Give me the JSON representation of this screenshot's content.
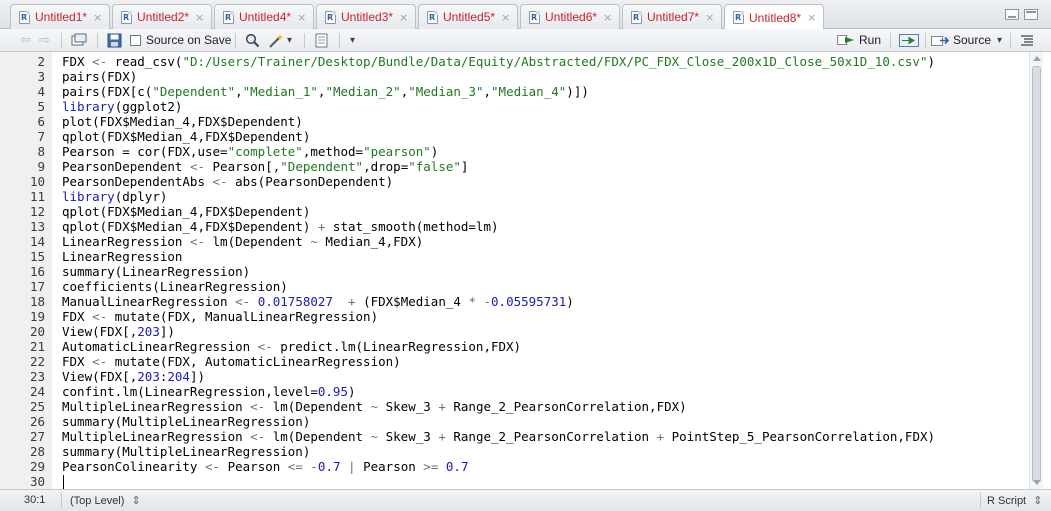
{
  "tabs": [
    {
      "label": "Untitled1*",
      "active": false
    },
    {
      "label": "Untitled2*",
      "active": false
    },
    {
      "label": "Untitled4*",
      "active": false
    },
    {
      "label": "Untitled3*",
      "active": false
    },
    {
      "label": "Untitled5*",
      "active": false
    },
    {
      "label": "Untitled6*",
      "active": false
    },
    {
      "label": "Untitled7*",
      "active": false
    },
    {
      "label": "Untitled8*",
      "active": true
    }
  ],
  "tab_close_glyph": "×",
  "toolbar": {
    "source_on_save_label": "Source on Save",
    "source_on_save_checked": false,
    "run_label": "Run",
    "source_label": "Source",
    "dropdown_glyph": "▾"
  },
  "lines": [
    {
      "n": "2",
      "tokens": [
        [
          "t",
          "FDX "
        ],
        [
          "op",
          "<-"
        ],
        [
          "t",
          " read_csv("
        ],
        [
          "str",
          "\"D:/Users/Trainer/Desktop/Bundle/Data/Equity/Abstracted/FDX/PC_FDX_Close_200x1D_Close_50x1D_10.csv\""
        ],
        [
          "t",
          ")"
        ]
      ]
    },
    {
      "n": "3",
      "tokens": [
        [
          "t",
          "pairs(FDX)"
        ]
      ]
    },
    {
      "n": "4",
      "tokens": [
        [
          "t",
          "pairs(FDX[c("
        ],
        [
          "str",
          "\"Dependent\""
        ],
        [
          "t",
          ","
        ],
        [
          "str",
          "\"Median_1\""
        ],
        [
          "t",
          ","
        ],
        [
          "str",
          "\"Median_2\""
        ],
        [
          "t",
          ","
        ],
        [
          "str",
          "\"Median_3\""
        ],
        [
          "t",
          ","
        ],
        [
          "str",
          "\"Median_4\""
        ],
        [
          "t",
          ")])"
        ]
      ]
    },
    {
      "n": "5",
      "tokens": [
        [
          "kw",
          "library"
        ],
        [
          "t",
          "(ggplot2)"
        ]
      ]
    },
    {
      "n": "6",
      "tokens": [
        [
          "t",
          "plot(FDX$Median_4,FDX$Dependent)"
        ]
      ]
    },
    {
      "n": "7",
      "tokens": [
        [
          "t",
          "qplot(FDX$Median_4,FDX$Dependent)"
        ]
      ]
    },
    {
      "n": "8",
      "tokens": [
        [
          "t",
          "Pearson = cor(FDX,use="
        ],
        [
          "str",
          "\"complete\""
        ],
        [
          "t",
          ",method="
        ],
        [
          "str",
          "\"pearson\""
        ],
        [
          "t",
          ")"
        ]
      ]
    },
    {
      "n": "9",
      "tokens": [
        [
          "t",
          "PearsonDependent "
        ],
        [
          "op",
          "<-"
        ],
        [
          "t",
          " Pearson[,"
        ],
        [
          "str",
          "\"Dependent\""
        ],
        [
          "t",
          ",drop="
        ],
        [
          "str",
          "\"false\""
        ],
        [
          "t",
          "]"
        ]
      ]
    },
    {
      "n": "10",
      "tokens": [
        [
          "t",
          "PearsonDependentAbs "
        ],
        [
          "op",
          "<-"
        ],
        [
          "t",
          " abs(PearsonDependent)"
        ]
      ]
    },
    {
      "n": "11",
      "tokens": [
        [
          "kw",
          "library"
        ],
        [
          "t",
          "(dplyr)"
        ]
      ]
    },
    {
      "n": "12",
      "tokens": [
        [
          "t",
          "qplot(FDX$Median_4,FDX$Dependent)"
        ]
      ]
    },
    {
      "n": "13",
      "tokens": [
        [
          "t",
          "qplot(FDX$Median_4,FDX$Dependent) "
        ],
        [
          "op",
          "+"
        ],
        [
          "t",
          " stat_smooth(method=lm)"
        ]
      ]
    },
    {
      "n": "14",
      "tokens": [
        [
          "t",
          "LinearRegression "
        ],
        [
          "op",
          "<-"
        ],
        [
          "t",
          " lm(Dependent "
        ],
        [
          "op",
          "~"
        ],
        [
          "t",
          " Median_4,FDX)"
        ]
      ]
    },
    {
      "n": "15",
      "tokens": [
        [
          "t",
          "LinearRegression"
        ]
      ]
    },
    {
      "n": "16",
      "tokens": [
        [
          "t",
          "summary(LinearRegression)"
        ]
      ]
    },
    {
      "n": "17",
      "tokens": [
        [
          "t",
          "coefficients(LinearRegression)"
        ]
      ]
    },
    {
      "n": "18",
      "tokens": [
        [
          "t",
          "ManualLinearRegression "
        ],
        [
          "op",
          "<-"
        ],
        [
          "t",
          " "
        ],
        [
          "num",
          "0.01758027"
        ],
        [
          "t",
          "  "
        ],
        [
          "op",
          "+"
        ],
        [
          "t",
          " (FDX$Median_4 "
        ],
        [
          "op",
          "*"
        ],
        [
          "t",
          " "
        ],
        [
          "op",
          "-"
        ],
        [
          "num",
          "0.05595731"
        ],
        [
          "t",
          ")"
        ]
      ]
    },
    {
      "n": "19",
      "tokens": [
        [
          "t",
          "FDX "
        ],
        [
          "op",
          "<-"
        ],
        [
          "t",
          " mutate(FDX, ManualLinearRegression)"
        ]
      ]
    },
    {
      "n": "20",
      "tokens": [
        [
          "t",
          "View(FDX[,"
        ],
        [
          "num",
          "203"
        ],
        [
          "t",
          "])"
        ]
      ]
    },
    {
      "n": "21",
      "tokens": [
        [
          "t",
          "AutomaticLinearRegression "
        ],
        [
          "op",
          "<-"
        ],
        [
          "t",
          " predict.lm(LinearRegression,FDX)"
        ]
      ]
    },
    {
      "n": "22",
      "tokens": [
        [
          "t",
          "FDX "
        ],
        [
          "op",
          "<-"
        ],
        [
          "t",
          " mutate(FDX, AutomaticLinearRegression)"
        ]
      ]
    },
    {
      "n": "23",
      "tokens": [
        [
          "t",
          "View(FDX[,"
        ],
        [
          "num",
          "203"
        ],
        [
          "t",
          ":"
        ],
        [
          "num",
          "204"
        ],
        [
          "t",
          "])"
        ]
      ]
    },
    {
      "n": "24",
      "tokens": [
        [
          "t",
          "confint.lm(LinearRegression,level="
        ],
        [
          "num",
          "0.95"
        ],
        [
          "t",
          ")"
        ]
      ]
    },
    {
      "n": "25",
      "tokens": [
        [
          "t",
          "MultipleLinearRegression "
        ],
        [
          "op",
          "<-"
        ],
        [
          "t",
          " lm(Dependent "
        ],
        [
          "op",
          "~"
        ],
        [
          "t",
          " Skew_3 "
        ],
        [
          "op",
          "+"
        ],
        [
          "t",
          " Range_2_PearsonCorrelation,FDX)"
        ]
      ]
    },
    {
      "n": "26",
      "tokens": [
        [
          "t",
          "summary(MultipleLinearRegression)"
        ]
      ]
    },
    {
      "n": "27",
      "tokens": [
        [
          "t",
          "MultipleLinearRegression "
        ],
        [
          "op",
          "<-"
        ],
        [
          "t",
          " lm(Dependent "
        ],
        [
          "op",
          "~"
        ],
        [
          "t",
          " Skew_3 "
        ],
        [
          "op",
          "+"
        ],
        [
          "t",
          " Range_2_PearsonCorrelation "
        ],
        [
          "op",
          "+"
        ],
        [
          "t",
          " PointStep_5_PearsonCorrelation,FDX)"
        ]
      ]
    },
    {
      "n": "28",
      "tokens": [
        [
          "t",
          "summary(MultipleLinearRegression)"
        ]
      ]
    },
    {
      "n": "29",
      "tokens": [
        [
          "t",
          "PearsonColinearity "
        ],
        [
          "op",
          "<-"
        ],
        [
          "t",
          " Pearson "
        ],
        [
          "op",
          "<="
        ],
        [
          "t",
          " "
        ],
        [
          "op",
          "-"
        ],
        [
          "num",
          "0.7"
        ],
        [
          "t",
          " "
        ],
        [
          "op",
          "|"
        ],
        [
          "t",
          " Pearson "
        ],
        [
          "op",
          ">="
        ],
        [
          "t",
          " "
        ],
        [
          "num",
          "0.7"
        ]
      ]
    },
    {
      "n": "30",
      "tokens": []
    }
  ],
  "status": {
    "position": "30:1",
    "scope": "(Top Level)",
    "scope_glyph": "⇕",
    "filetype": "R Script",
    "filetype_glyph": "⇕"
  },
  "colors": {
    "keyword": "#1b1bb8",
    "string": "#1f7a1f",
    "number": "#1b1bb8",
    "operator": "#707070",
    "tab_label": "#c8242a"
  },
  "icons": [
    "back-arrow-icon",
    "forward-arrow-icon",
    "show-in-window-icon",
    "save-icon",
    "search-icon",
    "magic-wand-icon",
    "compile-report-icon",
    "run-icon",
    "rerun-icon",
    "source-icon",
    "outline-icon",
    "maximize-icon",
    "restore-icon",
    "file-r-icon"
  ]
}
